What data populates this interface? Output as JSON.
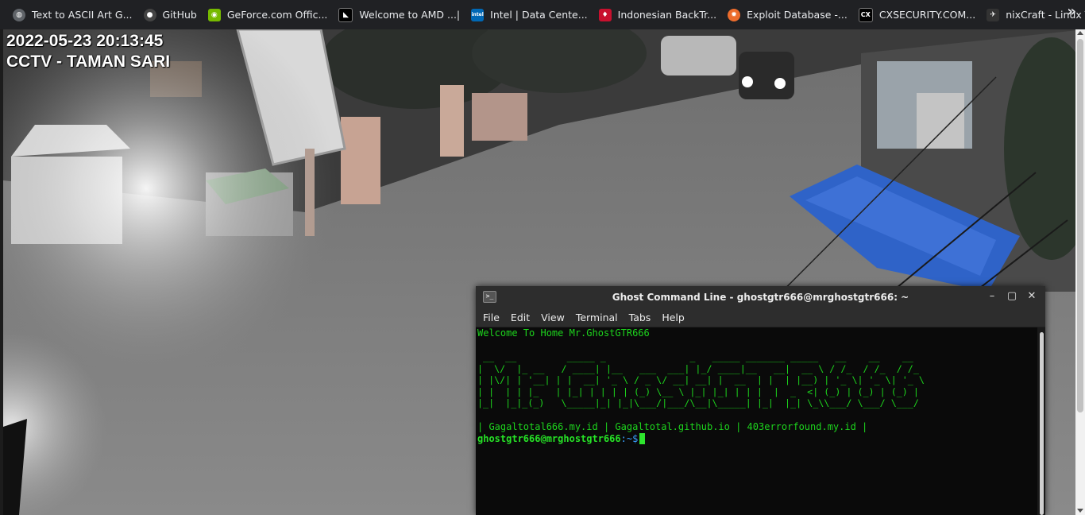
{
  "bookmarks": [
    {
      "label": "Text to ASCII Art G...",
      "icon": "globe-icon",
      "color": "#5f6368"
    },
    {
      "label": "GitHub",
      "icon": "github-icon",
      "color": "#24292e"
    },
    {
      "label": "GeForce.com Offic...",
      "icon": "nvidia-icon",
      "color": "#76b900"
    },
    {
      "label": "Welcome to AMD ...|",
      "icon": "amd-icon",
      "color": "#000000"
    },
    {
      "label": "Intel | Data Cente...",
      "icon": "intel-icon",
      "color": "#0068b5"
    },
    {
      "label": "Indonesian BackTr...",
      "icon": "backtrack-icon",
      "color": "#c8102e"
    },
    {
      "label": "Exploit Database -...",
      "icon": "exploitdb-icon",
      "color": "#ec6c2c"
    },
    {
      "label": "CXSECURITY.COM...",
      "icon": "cxsecurity-icon",
      "color": "#000000"
    },
    {
      "label": "nixCraft - Linux Tip...",
      "icon": "nixcraft-icon",
      "color": "#333333"
    }
  ],
  "bookmark_icon_text": {
    "intel": "intel",
    "cx": "CX"
  },
  "overflow_label": "»",
  "cctv": {
    "timestamp": "2022-05-23  20:13:45",
    "location": "CCTV - TAMAN SARI"
  },
  "terminal": {
    "title": "Ghost Command Line - ghostgtr666@mrghostgtr666: ~",
    "menu": [
      "File",
      "Edit",
      "View",
      "Terminal",
      "Tabs",
      "Help"
    ],
    "welcome": "Welcome To Home Mr.GhostGTR666",
    "ascii_art": " __  __         _____ _               _   _____ _______ _____   __    __    __  \n|  \\/  |_ __   / ____| |__   ___  ___| |_/ ____|__   __|  __ \\ / /_  / /_  / /_ \n| |\\/| | '__| | |  __| '_ \\ / _ \\/ __| __| |  __  | |  | |__) | '_ \\| '_ \\| '_ \\\n| |  | | |_   | |_| | | | | (_) \\__ \\ |_| |_| | | |  |  _  <| (_) | (_) | (_) |\n|_|  |_|_(_)   \\_____|_| |_|\\___/|___/\\__|\\_____| |_|  |_| \\_\\\\___/ \\___/ \\___/",
    "links": "| Gagaltotal666.my.id | Gagaltotal.github.io | 403errorfound.my.id |",
    "prompt_user": "ghostgtr666@mrghostgtr666",
    "prompt_path": ":~$"
  },
  "colors": {
    "terminal_green": "#1dd41d",
    "tarp_blue": "#2f63c8"
  }
}
